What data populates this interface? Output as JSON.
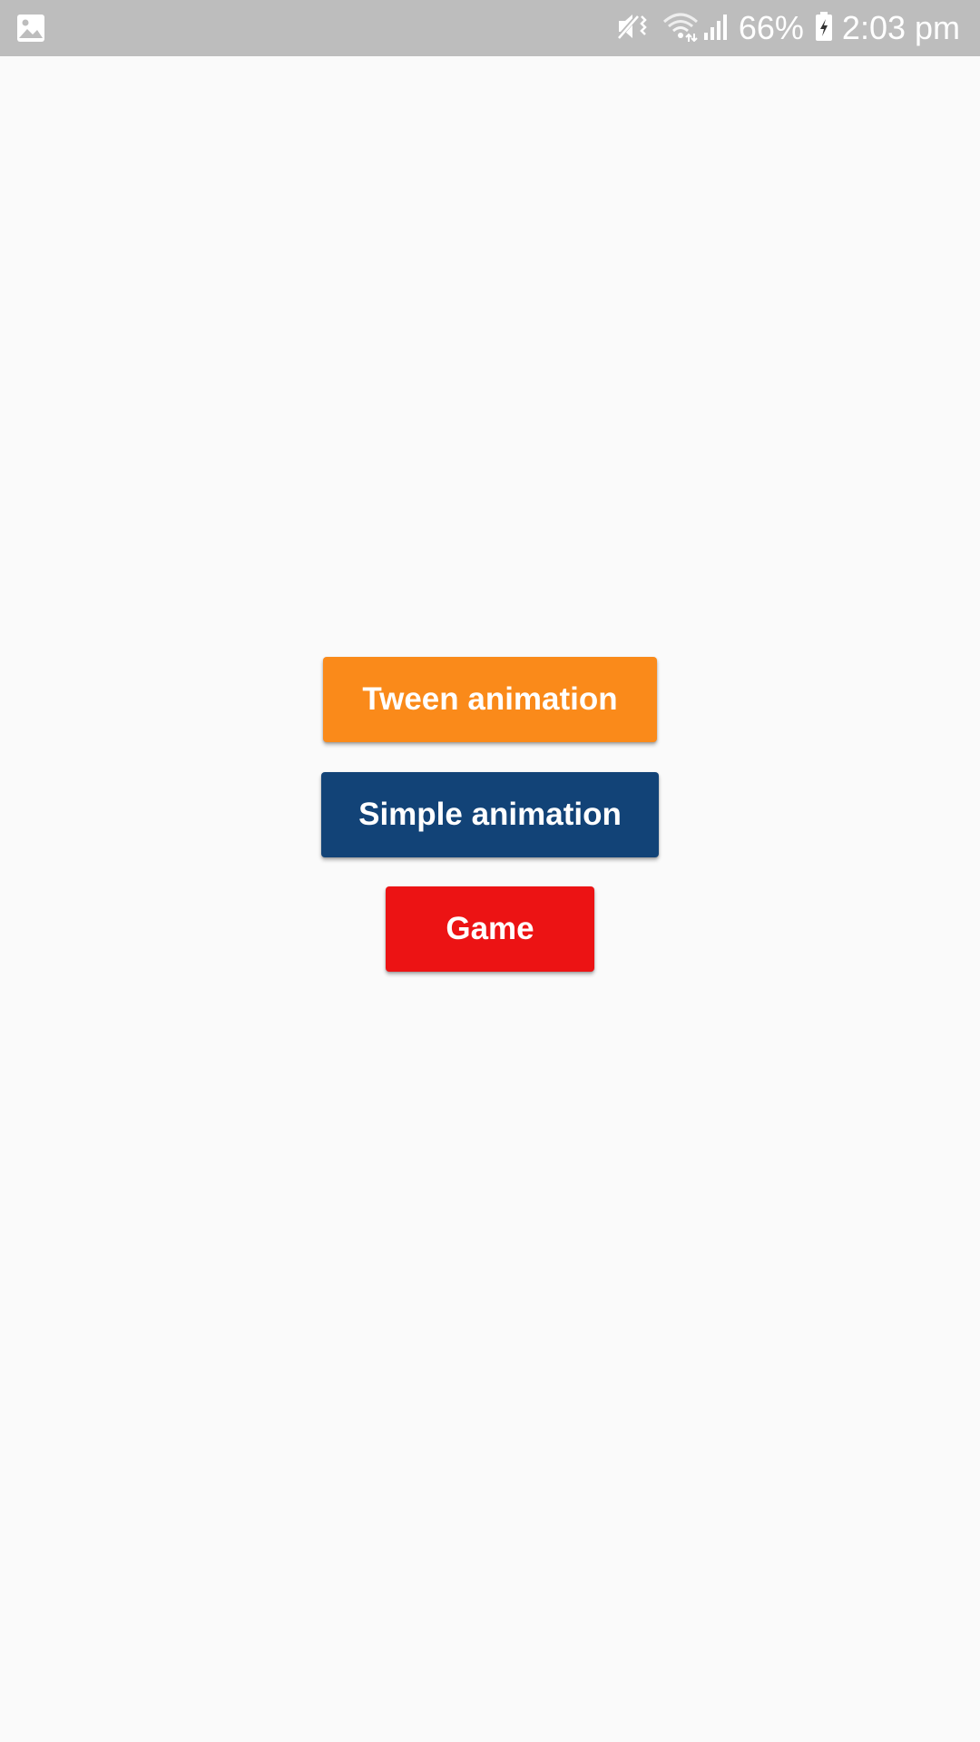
{
  "status_bar": {
    "left_icon": "image-icon",
    "battery_percent": "66%",
    "time": "2:03 pm",
    "icons": [
      "mute-vibrate-icon",
      "wifi-icon",
      "signal-icon",
      "battery-charging-icon"
    ],
    "background": "#BDBDBD"
  },
  "main": {
    "background": "#FAFAFA",
    "buttons": [
      {
        "label": "Tween animation",
        "color": "#FA8A1A"
      },
      {
        "label": "Simple animation",
        "color": "#124377"
      },
      {
        "label": "Game",
        "color": "#EC1314"
      }
    ]
  }
}
